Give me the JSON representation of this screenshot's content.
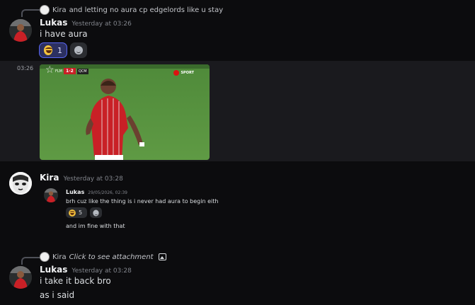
{
  "msg1": {
    "reply_author": "Kira",
    "reply_text": "and letting no aura cp edgelords like u stay",
    "author": "Lukas",
    "timestamp": "Yesterday at 03:26",
    "text": "i have aura",
    "reaction_count": "1"
  },
  "embed_row": {
    "time": "03:26",
    "video": {
      "score": "1-2",
      "team_left": "FLM",
      "team_right": "QCM",
      "channel": "SPORT"
    }
  },
  "msg2": {
    "author": "Kira",
    "timestamp": "Yesterday at 03:28",
    "quote": {
      "author": "Lukas",
      "date": "29/05/2026, 02:39",
      "text": "brh cuz like the thing is i never had aura to begin eith",
      "reaction_count": "5",
      "followup": "and im fine with that"
    }
  },
  "msg3": {
    "reply_author": "Kira",
    "reply_text": "Click to see attachment",
    "author": "Lukas",
    "timestamp": "Yesterday at 03:28",
    "lines": [
      "i take it back bro",
      "as i said"
    ]
  },
  "colors": {
    "background": "#0c0c0e",
    "embed_row": "#1a1a1e",
    "reaction_active": "#5865f2",
    "jersey_red": "#c92026"
  }
}
